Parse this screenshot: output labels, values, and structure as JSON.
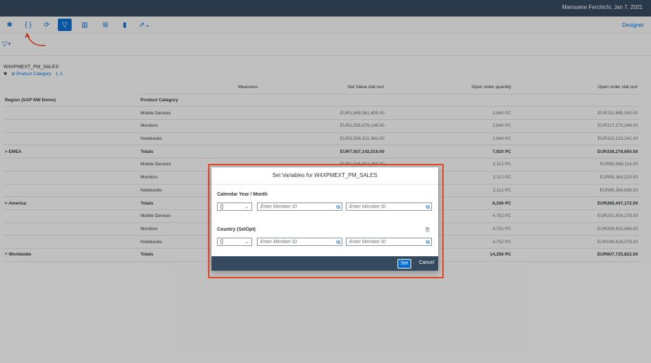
{
  "header": {
    "user_date": "Marouene Ferchichi, Jan 7, 2021"
  },
  "toolbar": {
    "designer_label": "Designer",
    "icons": [
      "navigation-panel-icon",
      "variables-icon",
      "refresh-icon",
      "filter-icon",
      "table-settings-icon",
      "pivot-icon",
      "bookmark-icon",
      "export-icon"
    ]
  },
  "datasource": {
    "name": "W4XPMEXT_PM_SALES",
    "filter_label": "Product Category",
    "filter_count": "1"
  },
  "table": {
    "measures_label": "Measures",
    "columns": [
      "Net Value stat curr",
      "Open order quantity",
      "Open order stat curr"
    ],
    "row_header_region": "Region (SAP NW Demo)",
    "row_header_product": "Product Category",
    "rows": [
      {
        "region": "",
        "product": "Mobile Devices",
        "v1": "EUR1,869,361,405.00",
        "v2": "2,640 PC",
        "v3": "EUR110,885,062.00",
        "total": false
      },
      {
        "region": "",
        "product": "Monitors",
        "v1": "EUR2,558,679,148.00",
        "v2": "2,640 PC",
        "v3": "EUR117,270,346.00",
        "total": false
      },
      {
        "region": "",
        "product": "Notebooks",
        "v1": "EUR3,509,101,463.00",
        "v2": "2,640 PC",
        "v3": "EUR110,123,242.00",
        "total": false
      },
      {
        "region": "> EMEA",
        "product": "Totals",
        "v1": "EUR7,937,142,016.00",
        "v2": "7,920 PC",
        "v3": "EUR338,278,650.00",
        "total": true
      },
      {
        "region": "",
        "product": "Mobile Devices",
        "v1": "EUR1,546,654,385.00",
        "v2": "2,112 PC",
        "v3": "EUR90,669,116.00",
        "total": false
      },
      {
        "region": "",
        "product": "Monitors",
        "v1": "",
        "v2": "2,112 PC",
        "v3": "EUR89,383,220.00",
        "total": false
      },
      {
        "region": "",
        "product": "Notebooks",
        "v1": "",
        "v2": "2,112 PC",
        "v3": "EUR89,394,836.00",
        "total": false
      },
      {
        "region": "> America",
        "product": "Totals",
        "v1": "",
        "v2": "6,336 PC",
        "v3": "EUR269,447,172.00",
        "total": true
      },
      {
        "region": "",
        "product": "Mobile Devices",
        "v1": "",
        "v2": "4,752 PC",
        "v3": "EUR201,554,178.00",
        "total": false
      },
      {
        "region": "",
        "product": "Monitors",
        "v1": "",
        "v2": "4,752 PC",
        "v3": "EUR206,653,566.00",
        "total": false
      },
      {
        "region": "",
        "product": "Notebooks",
        "v1": "",
        "v2": "4,752 PC",
        "v3": "EUR199,518,078.00",
        "total": false
      },
      {
        "region": "^ Worldwide",
        "product": "Totals",
        "v1": "",
        "v2": "14,256 PC",
        "v3": "EUR607,725,822.00",
        "total": true
      }
    ]
  },
  "dialog": {
    "title": "Set Variables for W4XPMEXT_PM_SALES",
    "var1_label": "Calendar Year / Month",
    "var2_label": "Country (SelOpt)",
    "operator": "[]",
    "placeholder": "Enter Member ID",
    "set_label": "Set",
    "cancel_label": "Cancel"
  },
  "colors": {
    "shell": "#354a5f",
    "accent": "#0a6ed1",
    "highlight": "#e8431f"
  }
}
